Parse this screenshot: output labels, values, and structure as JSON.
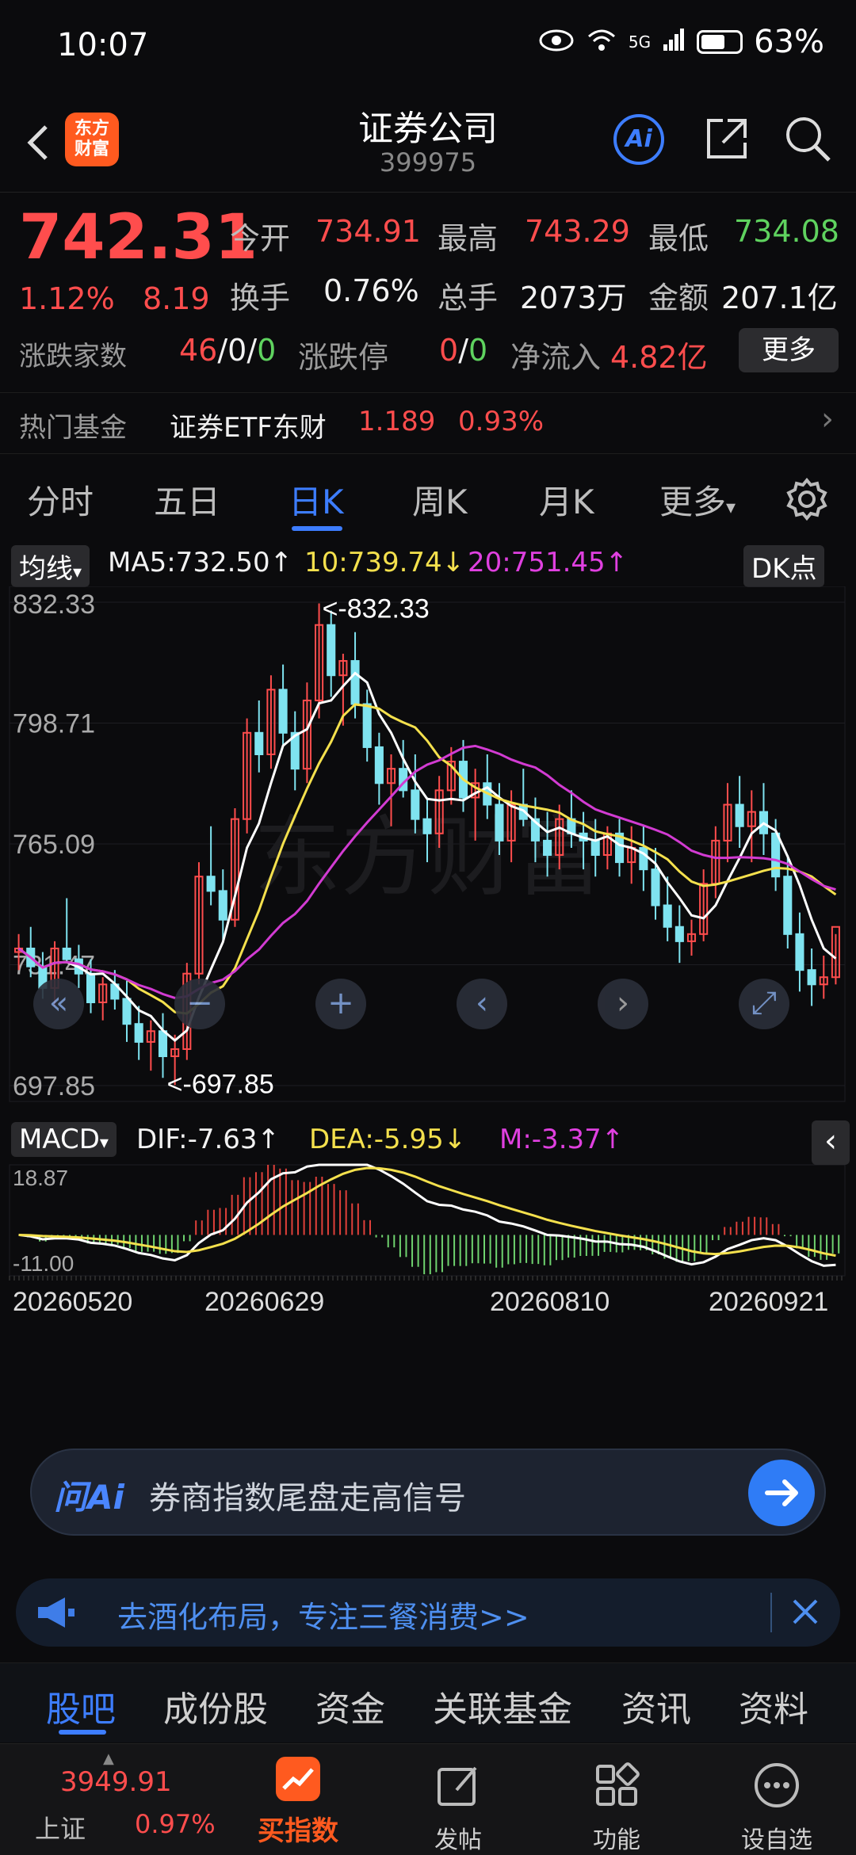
{
  "status": {
    "time": "10:07",
    "network": "5G",
    "battery": "63%",
    "battery_level": 0.63
  },
  "header": {
    "logo_line1": "东方",
    "logo_line2": "财富",
    "title": "证券公司",
    "code": "399975",
    "ai_label": "Ai"
  },
  "quote": {
    "price": "742.31",
    "change_pct": "1.12%",
    "change": "8.19",
    "open_label": "今开",
    "open": "734.91",
    "high_label": "最高",
    "high": "743.29",
    "low_label": "最低",
    "low": "734.08",
    "turnover_label": "换手",
    "turnover": "0.76%",
    "volume_label": "总手",
    "volume": "2073万",
    "amount_label": "金额",
    "amount": "207.1亿",
    "breadth_label": "涨跌家数",
    "breadth_up": "46",
    "breadth_flat": "0",
    "breadth_down": "0",
    "limit_label": "涨跌停",
    "limit_up": "0",
    "limit_down": "0",
    "netflow_label": "净流入",
    "netflow": "4.82亿",
    "more_label": "更多"
  },
  "fund": {
    "label": "热门基金",
    "name": "证券ETF东财",
    "price": "1.189",
    "pct": "0.93%"
  },
  "tabs": [
    {
      "label": "分时"
    },
    {
      "label": "五日"
    },
    {
      "label": "日K"
    },
    {
      "label": "周K"
    },
    {
      "label": "月K"
    },
    {
      "label": "更多"
    }
  ],
  "chart_header": {
    "ma_select": "均线",
    "ma5": "MA5:732.50↑",
    "ma10": "10:739.74↓",
    "ma20": "20:751.45↑",
    "dk": "DK点",
    "max_label": "<-832.33",
    "min_label": "<-697.85",
    "watermark": "东方财富"
  },
  "chart_data": {
    "type": "candlestick",
    "yticks": [
      "832.33",
      "798.71",
      "765.09",
      "731.47",
      "697.85"
    ],
    "ylim": [
      697.85,
      832.33
    ],
    "xticks": [
      "20260520",
      "20260629",
      "20260810",
      "20260921"
    ],
    "ma_colors": {
      "ma5": "#ffffff",
      "ma10": "#f4e04d",
      "ma20": "#d23bd2"
    },
    "candles": [
      [
        735,
        740,
        730,
        736
      ],
      [
        736,
        742,
        728,
        731
      ],
      [
        731,
        735,
        722,
        725
      ],
      [
        725,
        738,
        720,
        736
      ],
      [
        736,
        750,
        732,
        733
      ],
      [
        733,
        737,
        725,
        729
      ],
      [
        729,
        733,
        718,
        721
      ],
      [
        721,
        728,
        716,
        726
      ],
      [
        726,
        730,
        719,
        722
      ],
      [
        722,
        727,
        710,
        715
      ],
      [
        715,
        720,
        705,
        710
      ],
      [
        710,
        716,
        702,
        713
      ],
      [
        713,
        718,
        700,
        706
      ],
      [
        706,
        712,
        698,
        708
      ],
      [
        708,
        732,
        705,
        729
      ],
      [
        729,
        760,
        726,
        756
      ],
      [
        756,
        770,
        748,
        752
      ],
      [
        752,
        758,
        738,
        744
      ],
      [
        744,
        775,
        742,
        772
      ],
      [
        772,
        800,
        768,
        796
      ],
      [
        796,
        805,
        785,
        790
      ],
      [
        790,
        812,
        786,
        808
      ],
      [
        808,
        815,
        792,
        796
      ],
      [
        796,
        802,
        780,
        786
      ],
      [
        786,
        810,
        782,
        805
      ],
      [
        805,
        832,
        800,
        826
      ],
      [
        826,
        830,
        806,
        812
      ],
      [
        812,
        818,
        798,
        816
      ],
      [
        816,
        824,
        800,
        804
      ],
      [
        804,
        808,
        788,
        792
      ],
      [
        792,
        796,
        776,
        782
      ],
      [
        782,
        790,
        770,
        786
      ],
      [
        786,
        794,
        778,
        780
      ],
      [
        780,
        790,
        768,
        772
      ],
      [
        772,
        778,
        760,
        768
      ],
      [
        768,
        784,
        764,
        780
      ],
      [
        780,
        792,
        776,
        788
      ],
      [
        788,
        794,
        774,
        778
      ],
      [
        778,
        786,
        766,
        782
      ],
      [
        782,
        790,
        772,
        776
      ],
      [
        776,
        782,
        762,
        766
      ],
      [
        766,
        780,
        760,
        776
      ],
      [
        776,
        786,
        770,
        772
      ],
      [
        772,
        778,
        760,
        766
      ],
      [
        766,
        774,
        756,
        762
      ],
      [
        762,
        776,
        758,
        772
      ],
      [
        772,
        780,
        764,
        768
      ],
      [
        768,
        774,
        758,
        766
      ],
      [
        766,
        772,
        756,
        762
      ],
      [
        762,
        770,
        758,
        768
      ],
      [
        768,
        772,
        756,
        760
      ],
      [
        760,
        770,
        754,
        764
      ],
      [
        764,
        770,
        752,
        758
      ],
      [
        758,
        764,
        744,
        748
      ],
      [
        748,
        756,
        738,
        742
      ],
      [
        742,
        748,
        732,
        738
      ],
      [
        738,
        744,
        734,
        740
      ],
      [
        740,
        758,
        738,
        754
      ],
      [
        754,
        770,
        750,
        766
      ],
      [
        766,
        782,
        760,
        776
      ],
      [
        776,
        784,
        764,
        770
      ],
      [
        770,
        780,
        760,
        774
      ],
      [
        774,
        782,
        762,
        768
      ],
      [
        768,
        772,
        752,
        756
      ],
      [
        756,
        762,
        736,
        740
      ],
      [
        740,
        746,
        724,
        730
      ],
      [
        730,
        736,
        720,
        726
      ],
      [
        726,
        734,
        722,
        728
      ],
      [
        728,
        740,
        726,
        742
      ]
    ],
    "macd": {
      "dif": "-7.63",
      "dea": "-5.95",
      "m": "-3.37",
      "ymax": "18.87",
      "ymin": "-11.00"
    }
  },
  "nav_buttons": {
    "rewind": "«",
    "zoom_out": "−",
    "zoom_in": "+",
    "prev": "‹",
    "next": "›",
    "fullscreen": "⤢"
  },
  "macd_header": {
    "select": "MACD",
    "dif": "DIF:-7.63↑",
    "dea": "DEA:-5.95↓",
    "m": "M:-3.37↑"
  },
  "askai": {
    "logo": "问Ai",
    "text": "券商指数尾盘走高信号"
  },
  "ad": {
    "text": "去酒化布局，专注三餐消费>>"
  },
  "subtabs": [
    {
      "label": "股吧"
    },
    {
      "label": "成份股"
    },
    {
      "label": "资金"
    },
    {
      "label": "关联基金"
    },
    {
      "label": "资讯"
    },
    {
      "label": "资料"
    }
  ],
  "bottomnav": {
    "index_value": "3949.91",
    "index_name": "上证",
    "index_pct": "0.97%",
    "items": [
      {
        "label": "买指数"
      },
      {
        "label": "发帖"
      },
      {
        "label": "功能"
      },
      {
        "label": "设自选"
      }
    ]
  }
}
